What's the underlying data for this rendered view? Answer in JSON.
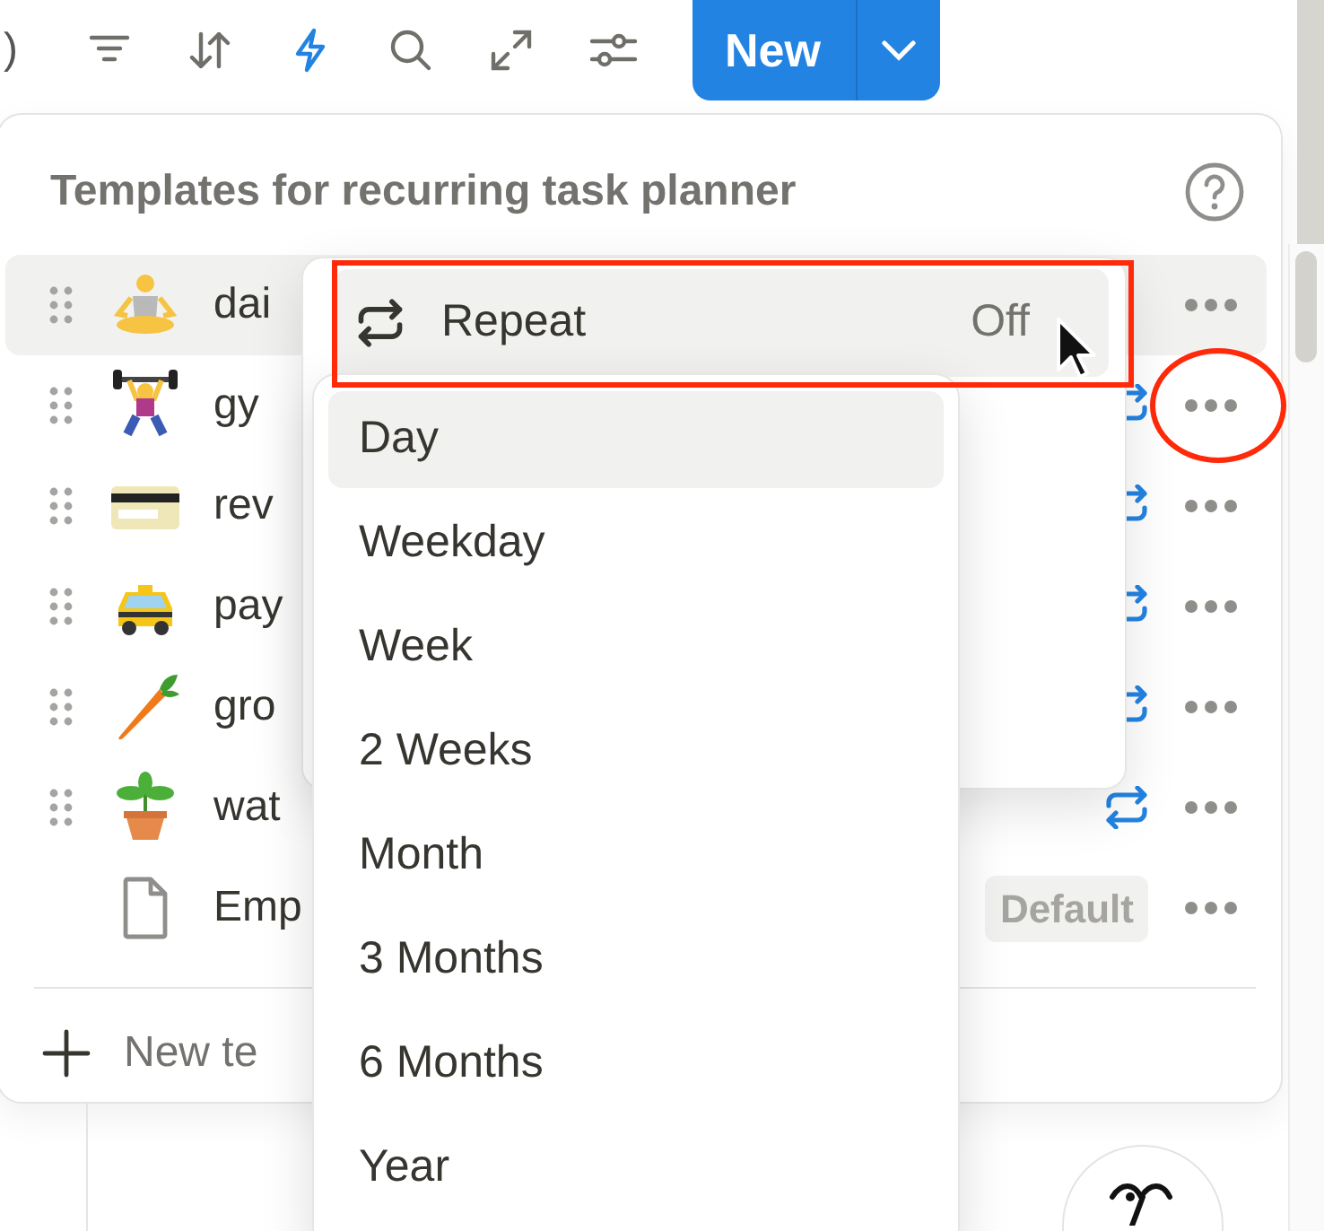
{
  "toolbar": {
    "count_fragment": ")",
    "tools": [
      {
        "kind": "filter",
        "active": false
      },
      {
        "kind": "sort",
        "active": false
      },
      {
        "kind": "automation",
        "active": true
      },
      {
        "kind": "search",
        "active": false
      },
      {
        "kind": "expand",
        "active": false
      },
      {
        "kind": "settings",
        "active": false
      }
    ],
    "new_button": {
      "label": "New"
    }
  },
  "templates_panel": {
    "title": "Templates for recurring task planner",
    "rows": [
      {
        "name": "dai",
        "hovered": true,
        "repeating": false,
        "circled": false
      },
      {
        "name": "gy",
        "hovered": false,
        "repeating": true,
        "circled": true
      },
      {
        "name": "rev",
        "hovered": false,
        "repeating": true,
        "circled": false
      },
      {
        "name": "pay",
        "hovered": false,
        "repeating": true,
        "circled": false
      },
      {
        "name": "gro",
        "hovered": false,
        "repeating": true,
        "circled": false
      },
      {
        "name": "wat",
        "hovered": false,
        "repeating": true,
        "circled": false
      }
    ],
    "empty_row": {
      "name": "Emp",
      "badge": "Default"
    },
    "new_template": "New te"
  },
  "repeat_menu": {
    "label": "Repeat",
    "value": "Off",
    "highlighted": true,
    "options": [
      {
        "label": "Day",
        "selected": true
      },
      {
        "label": "Weekday",
        "selected": false
      },
      {
        "label": "Week",
        "selected": false
      },
      {
        "label": "2 Weeks",
        "selected": false
      },
      {
        "label": "Month",
        "selected": false
      },
      {
        "label": "3 Months",
        "selected": false
      },
      {
        "label": "6 Months",
        "selected": false
      },
      {
        "label": "Year",
        "selected": false
      }
    ]
  }
}
